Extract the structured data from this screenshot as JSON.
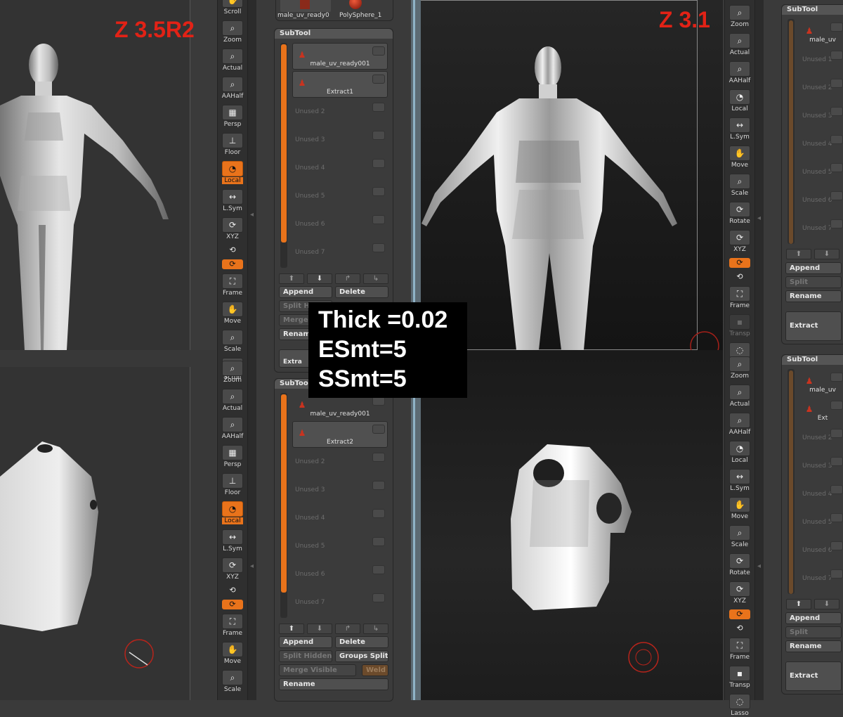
{
  "versions": {
    "left": "Z 3.5R2",
    "right": "Z 3.1"
  },
  "overlay": {
    "lines": [
      "Thick =0.02",
      "ESmt=5",
      "SSmt=5"
    ]
  },
  "shelf_left_top": [
    {
      "label": "Scroll",
      "state": "partial",
      "icon": "scroll-icon"
    },
    {
      "label": "Zoom",
      "icon": "zoom-icon"
    },
    {
      "label": "Actual",
      "icon": "actual-icon"
    },
    {
      "label": "AAHalf",
      "icon": "aahalf-icon"
    },
    {
      "label": "Persp",
      "icon": "persp-icon"
    },
    {
      "label": "Floor",
      "icon": "floor-icon"
    },
    {
      "label": "Local",
      "state": "on",
      "icon": "local-icon"
    },
    {
      "label": "L.Sym",
      "icon": "lsym-icon"
    },
    {
      "label": "XYZ",
      "icon": "xyz-icon"
    },
    {
      "label": "",
      "icon": "rotate-z-icon"
    },
    {
      "label": "",
      "state": "on",
      "icon": "rotate-y-icon"
    },
    {
      "label": "Frame",
      "icon": "frame-icon"
    },
    {
      "label": "Move",
      "icon": "move-icon"
    },
    {
      "label": "Scale",
      "icon": "scale-icon"
    },
    {
      "label": "Scroll",
      "icon": "scroll-icon"
    }
  ],
  "shelf_left_bottom": [
    {
      "label": "Zoom",
      "icon": "zoom-icon"
    },
    {
      "label": "Actual",
      "icon": "actual-icon"
    },
    {
      "label": "AAHalf",
      "icon": "aahalf-icon"
    },
    {
      "label": "Persp",
      "icon": "persp-icon"
    },
    {
      "label": "Floor",
      "icon": "floor-icon"
    },
    {
      "label": "Local",
      "state": "on",
      "icon": "local-icon"
    },
    {
      "label": "L.Sym",
      "icon": "lsym-icon"
    },
    {
      "label": "XYZ",
      "icon": "xyz-icon"
    },
    {
      "label": "",
      "icon": "rotate-z-icon"
    },
    {
      "label": "",
      "state": "on",
      "icon": "rotate-y-icon"
    },
    {
      "label": "Frame",
      "icon": "frame-icon"
    },
    {
      "label": "Move",
      "icon": "move-icon"
    },
    {
      "label": "Scale",
      "icon": "scale-icon"
    }
  ],
  "shelf_right_top": [
    {
      "label": "Zoom",
      "icon": "zoom-icon"
    },
    {
      "label": "Actual",
      "icon": "actual-icon"
    },
    {
      "label": "AAHalf",
      "icon": "aahalf-icon"
    },
    {
      "label": "Local",
      "icon": "local-icon"
    },
    {
      "label": "L.Sym",
      "icon": "lsym-icon"
    },
    {
      "label": "Move",
      "icon": "move-icon"
    },
    {
      "label": "Scale",
      "icon": "scale-icon"
    },
    {
      "label": "Rotate",
      "icon": "rotate-icon"
    },
    {
      "label": "XYZ",
      "icon": "xyz-icon"
    },
    {
      "label": "",
      "state": "on",
      "icon": "rotate-y-icon"
    },
    {
      "label": "",
      "icon": "rotate-z-icon"
    },
    {
      "label": "Frame",
      "icon": "frame-icon"
    },
    {
      "label": "Transp",
      "state": "dim",
      "icon": "transp-icon"
    },
    {
      "label": "Lasso",
      "icon": "lasso-icon"
    }
  ],
  "shelf_right_bottom": [
    {
      "label": "Zoom",
      "icon": "zoom-icon"
    },
    {
      "label": "Actual",
      "icon": "actual-icon"
    },
    {
      "label": "AAHalf",
      "icon": "aahalf-icon"
    },
    {
      "label": "Local",
      "icon": "local-icon"
    },
    {
      "label": "L.Sym",
      "icon": "lsym-icon"
    },
    {
      "label": "Move",
      "icon": "move-icon"
    },
    {
      "label": "Scale",
      "icon": "scale-icon"
    },
    {
      "label": "Rotate",
      "icon": "rotate-icon"
    },
    {
      "label": "XYZ",
      "icon": "xyz-icon"
    },
    {
      "label": "",
      "state": "on",
      "icon": "rotate-y-icon"
    },
    {
      "label": "",
      "icon": "rotate-z-icon"
    },
    {
      "label": "Frame",
      "icon": "frame-icon"
    },
    {
      "label": "Transp",
      "icon": "transp-icon"
    },
    {
      "label": "Lasso",
      "icon": "lasso-icon"
    }
  ],
  "tool_strip": {
    "items": [
      "male_uv_ready0",
      "PolySphere_1"
    ]
  },
  "subtool_a": {
    "title": "SubTool",
    "slots": [
      {
        "name": "male_uv_ready001",
        "selected": true
      },
      {
        "name": "Extract1",
        "selected": true
      },
      {
        "name": "Unused 2"
      },
      {
        "name": "Unused 3"
      },
      {
        "name": "Unused 4"
      },
      {
        "name": "Unused 5"
      },
      {
        "name": "Unused 6"
      },
      {
        "name": "Unused 7"
      }
    ],
    "append": "Append",
    "delete": "Delete",
    "split_hidden": "Split Hi",
    "merge": "Merge",
    "rename": "Renam",
    "extract": "Extra"
  },
  "subtool_b": {
    "title": "SubTool",
    "slots": [
      {
        "name": "male_uv_ready001",
        "selected": false
      },
      {
        "name": "Extract2",
        "selected": true
      },
      {
        "name": "Unused 2"
      },
      {
        "name": "Unused 3"
      },
      {
        "name": "Unused 4"
      },
      {
        "name": "Unused 5"
      },
      {
        "name": "Unused 6"
      },
      {
        "name": "Unused 7"
      }
    ],
    "append": "Append",
    "delete": "Delete",
    "split_hidden": "Split Hidden",
    "groups_split": "Groups Split",
    "merge_visible": "Merge Visible",
    "weld": "Weld",
    "rename": "Rename"
  },
  "subtool_c": {
    "title": "SubTool",
    "slots": [
      {
        "name": "male_uv"
      },
      {
        "name": "Unused 1"
      },
      {
        "name": "Unused 2"
      },
      {
        "name": "Unused 3"
      },
      {
        "name": "Unused 4"
      },
      {
        "name": "Unused 5"
      },
      {
        "name": "Unused 6"
      },
      {
        "name": "Unused 7"
      }
    ],
    "append": "Append",
    "split": "Split",
    "rename": "Rename",
    "extract": "Extract"
  },
  "subtool_d": {
    "title": "SubTool",
    "slots": [
      {
        "name": "male_uv"
      },
      {
        "name": "Ext"
      },
      {
        "name": "Unused 2"
      },
      {
        "name": "Unused 3"
      },
      {
        "name": "Unused 4"
      },
      {
        "name": "Unused 5"
      },
      {
        "name": "Unused 6"
      },
      {
        "name": "Unused 7"
      }
    ],
    "append": "Append",
    "split": "Split",
    "rename": "Rename",
    "extract": "Extract"
  },
  "colors": {
    "accent": "#e9731b",
    "label_red": "#e22216",
    "panel_bg": "#3b3b3b",
    "viewport_bg": "#1c1c1c"
  }
}
